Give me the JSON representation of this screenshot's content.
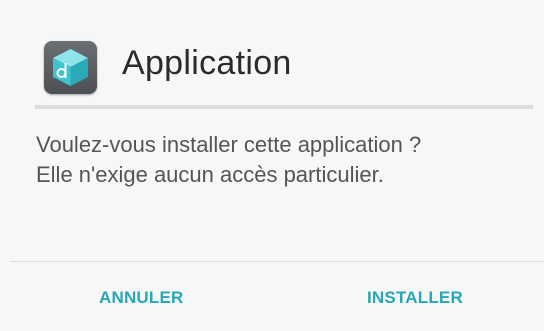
{
  "dialog": {
    "app": {
      "icon": "app-cube-icon",
      "title": "Application"
    },
    "message_lines": [
      "Voulez-vous installer cette application ?",
      "Elle n'exige aucun accès particulier."
    ],
    "buttons": {
      "cancel_label": "ANNULER",
      "install_label": "INSTALLER"
    },
    "colors": {
      "accent": "#26a7b7",
      "icon_teal": "#3fc3cf"
    }
  }
}
